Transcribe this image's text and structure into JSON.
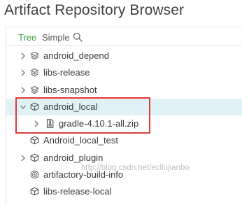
{
  "page": {
    "title": "Artifact Repository Browser"
  },
  "tabs": {
    "tree": "Tree",
    "simple": "Simple",
    "search_icon": "search-icon"
  },
  "tree": {
    "items": [
      {
        "label": "android_depend",
        "icon": "repo-icon",
        "expandable": true
      },
      {
        "label": "libs-release",
        "icon": "repo-icon",
        "expandable": true
      },
      {
        "label": "libs-snapshot",
        "icon": "repo-icon",
        "expandable": true
      },
      {
        "label": "android_local",
        "icon": "package-icon",
        "expandable": true,
        "expanded": true,
        "selected": true
      },
      {
        "label": "gradle-4.10.1-all.zip",
        "icon": "file-icon",
        "expandable": true,
        "child": true
      },
      {
        "label": "Android_local_test",
        "icon": "package-icon",
        "expandable": false
      },
      {
        "label": "android_plugin",
        "icon": "package-icon",
        "expandable": true
      },
      {
        "label": "artifactory-build-info",
        "icon": "build-info-icon",
        "expandable": false
      },
      {
        "label": "libs-release-local",
        "icon": "package-icon",
        "expandable": false
      }
    ]
  },
  "watermark": {
    "text": "http://blog.csdn.net/ecllujianbo"
  },
  "colors": {
    "accent": "#43a047",
    "selected_row": "#e1f2f6",
    "annotation_box": "#e23b3b"
  }
}
